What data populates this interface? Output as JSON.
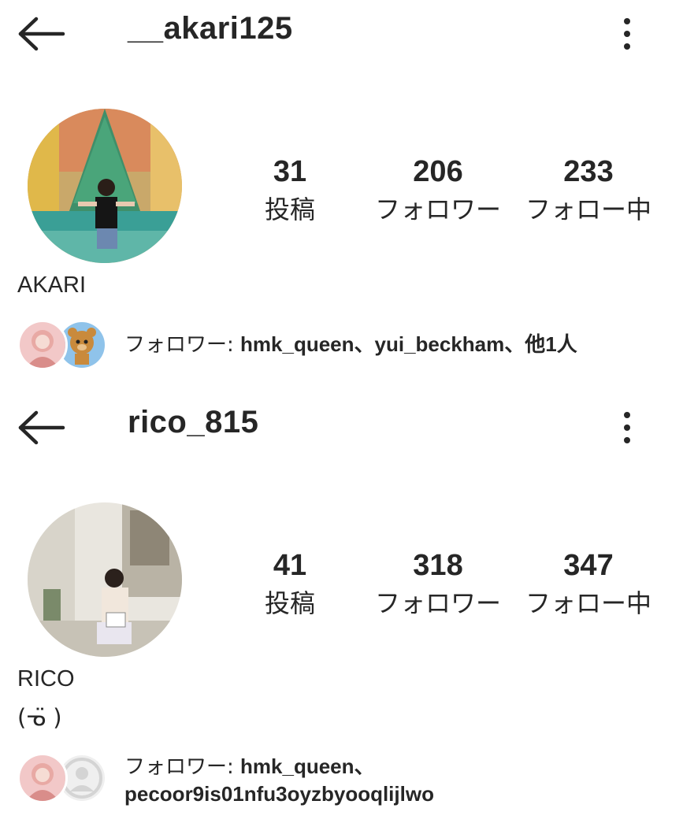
{
  "profiles": [
    {
      "username": "__akari125",
      "stats": {
        "posts": {
          "value": "31",
          "label": "投稿"
        },
        "followers": {
          "value": "206",
          "label": "フォロワー"
        },
        "following": {
          "value": "233",
          "label": "フォロー中"
        }
      },
      "name": "AKARI",
      "mutual": {
        "prefix": "フォロワー: ",
        "names": "hmk_queen、yui_beckham、他1人"
      }
    },
    {
      "username": "rico_815",
      "stats": {
        "posts": {
          "value": "41",
          "label": "投稿"
        },
        "followers": {
          "value": "318",
          "label": "フォロワー"
        },
        "following": {
          "value": "347",
          "label": "フォロー中"
        }
      },
      "name": "RICO",
      "bio": "(ᓀ̈ )",
      "mutual": {
        "prefix": "フォロワー: ",
        "names_line1": "hmk_queen、",
        "names_line2": "pecoor9is01nfu3oyzbyooqlijlwo"
      }
    }
  ],
  "icons": {
    "back": "back-arrow-icon",
    "more": "more-vertical-icon"
  }
}
